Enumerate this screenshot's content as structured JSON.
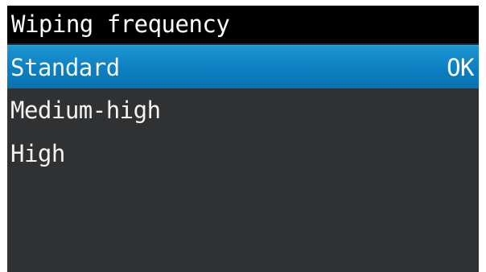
{
  "header": {
    "title": "Wiping frequency"
  },
  "menu": {
    "items": [
      {
        "label": "Standard",
        "selected": true,
        "confirm_label": "OK"
      },
      {
        "label": "Medium-high",
        "selected": false
      },
      {
        "label": "High",
        "selected": false
      }
    ]
  },
  "colors": {
    "title_bar": "#000000",
    "screen_background": "#2f3133",
    "selection_highlight": "#1a8bc9",
    "text": "#f2f2f2"
  }
}
